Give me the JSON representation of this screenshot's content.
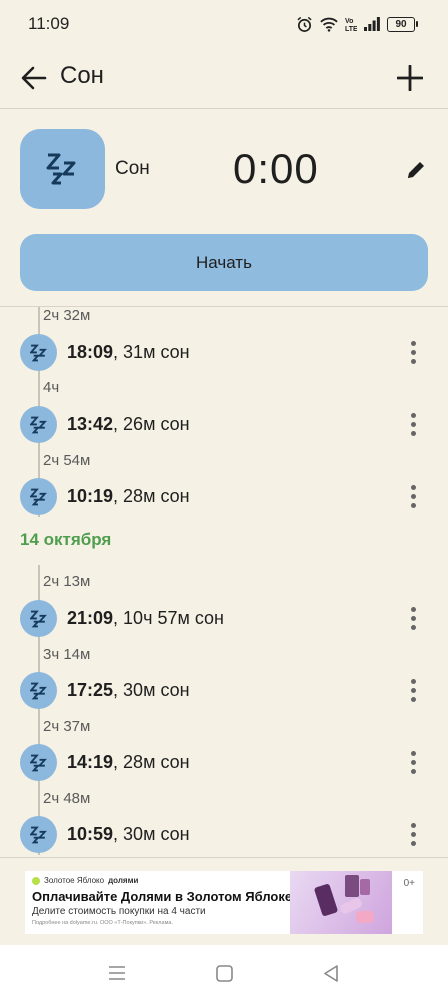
{
  "status_bar": {
    "time": "11:09",
    "battery": "90"
  },
  "app_bar": {
    "title": "Сон"
  },
  "header": {
    "activity_name": "Сон",
    "timer": "0:00",
    "start_label": "Начать"
  },
  "timeline": {
    "rows": [
      {
        "gap": "2ч 32м",
        "time": "18:09",
        "detail": ", 31м сон"
      },
      {
        "gap": "4ч",
        "time": "13:42",
        "detail": ", 26м сон"
      },
      {
        "gap": "2ч 54м",
        "time": "10:19",
        "detail": ", 28м сон"
      }
    ],
    "date_header": "14 октября",
    "rows2": [
      {
        "gap": "2ч 13м",
        "time": "21:09",
        "detail": ", 10ч 57м сон"
      },
      {
        "gap": "3ч 14м",
        "time": "17:25",
        "detail": ", 30м сон"
      },
      {
        "gap": "2ч 37м",
        "time": "14:19",
        "detail": ", 28м сон"
      },
      {
        "gap": "2ч 48м",
        "time": "10:59",
        "detail": ", 30м сон"
      }
    ]
  },
  "ad": {
    "brand": "Золотое Яблоко",
    "brand2": "долями",
    "headline": "Оплачивайте Долями в Золотом Яблоке",
    "subtitle": "Делите стоимость покупки на 4 части",
    "fine_print": "Подробнее на dolyame.ru. ООО «Т-Покупки». Реклама.",
    "age": "0+"
  },
  "colors": {
    "accent_blue": "#8db8dd",
    "date_green": "#4f9e4f",
    "background": "#f6f1e5"
  }
}
